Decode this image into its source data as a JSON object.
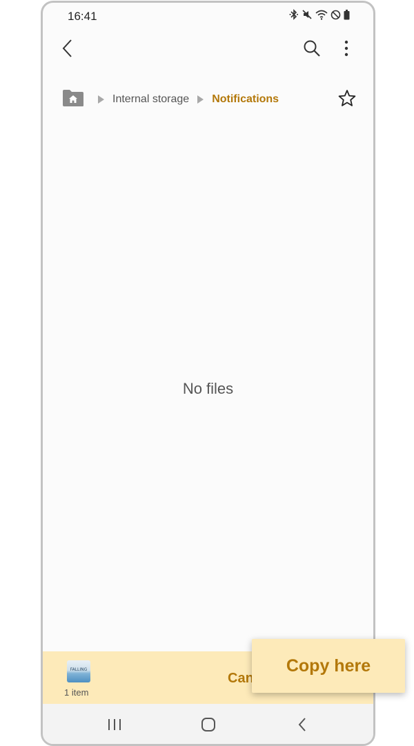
{
  "status_bar": {
    "time": "16:41",
    "icons": [
      "bluetooth-icon",
      "mute-icon",
      "wifi-icon",
      "do-not-disturb-icon",
      "battery-icon"
    ]
  },
  "top_bar": {
    "icons": [
      "back-icon",
      "search-icon",
      "more-icon"
    ]
  },
  "breadcrumb": {
    "home_icon": "home-folder-icon",
    "items": [
      {
        "label": "Internal storage"
      },
      {
        "label": "Notifications"
      }
    ],
    "favorite_icon": "star-icon"
  },
  "content": {
    "empty_message": "No files"
  },
  "bottom_panel": {
    "item_count": "1 item",
    "thumbnail_text": "FALLING",
    "cancel_label": "Can"
  },
  "copy_button": {
    "label": "Copy here"
  },
  "nav_bar": {
    "icons": [
      "recent-apps-icon",
      "home-icon",
      "nav-back-icon"
    ]
  },
  "colors": {
    "accent": "#b3780a",
    "panel": "#fdeab9",
    "background": "#fbfbfb"
  }
}
